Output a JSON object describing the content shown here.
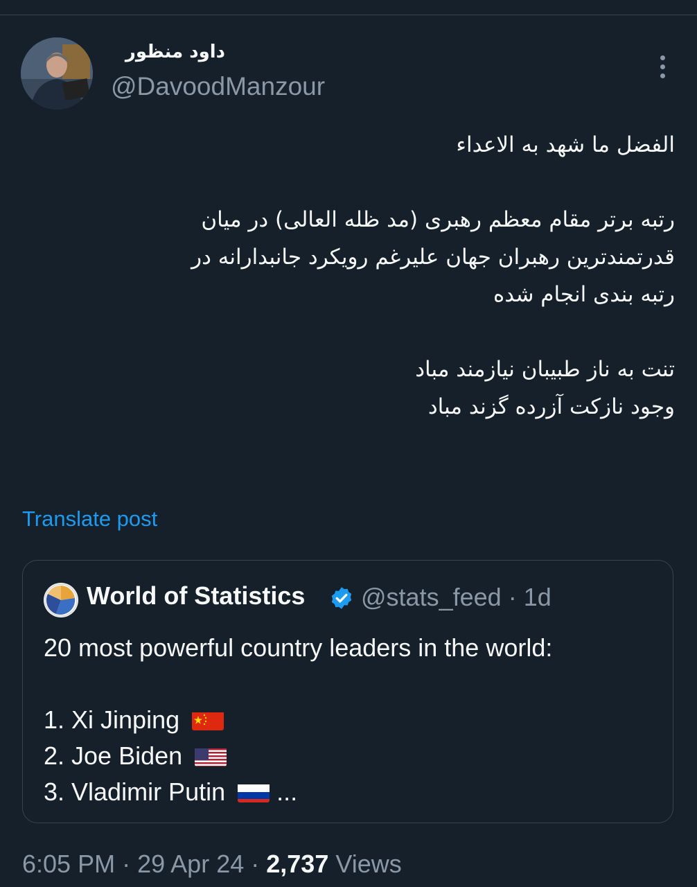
{
  "author": {
    "display_name": "داود منظور",
    "handle": "@DavoodManzour"
  },
  "post": {
    "lines_block1": [
      "الفضل ما شهد به الاعداء"
    ],
    "lines_block2": [
      "رتبه برتر مقام معظم رهبری (مد ظله العالی) در میان",
      "قدرتمندترین رهبران جهان علیرغم رویکرد جانبدارانه در",
      "رتبه بندی انجام شده"
    ],
    "lines_block3": [
      "تنت به ناز طبیبان نیازمند مباد",
      "وجود نازکت آزرده گزند مباد"
    ],
    "translate_label": "Translate post"
  },
  "quote": {
    "name": "World of Statistics",
    "handle": "@stats_feed",
    "separator": "·",
    "age": "1d",
    "intro": "20 most powerful country leaders in the world:",
    "items": [
      {
        "text": "1. Xi Jinping",
        "flag": "china-flag"
      },
      {
        "text": "2. Joe Biden",
        "flag": "usa-flag"
      },
      {
        "text": "3. Vladimir Putin",
        "flag": "russia-flag",
        "suffix": "..."
      }
    ]
  },
  "footer": {
    "time": "6:05 PM",
    "sep1": "·",
    "date": "29 Apr 24",
    "sep2": "·",
    "views_count": "2,737",
    "views_label": "Views"
  },
  "colors": {
    "background": "#15202b",
    "text": "#f7f9f9",
    "muted": "#8b98a5",
    "link": "#1d9bf0",
    "border": "#38444d"
  }
}
